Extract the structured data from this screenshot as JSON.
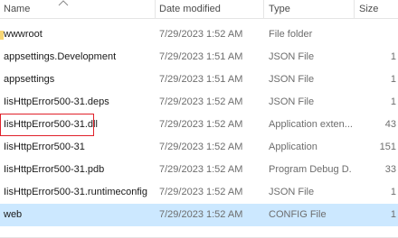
{
  "columns": {
    "name": "Name",
    "date": "Date modified",
    "type": "Type",
    "size": "Size"
  },
  "sort": {
    "column": "name",
    "direction": "ascending",
    "icon": "chevron-up-icon"
  },
  "files": [
    {
      "name": "wwwroot",
      "date": "7/29/2023 1:52 AM",
      "type": "File folder",
      "size": "",
      "icon": "folder-icon"
    },
    {
      "name": "appsettings.Development",
      "date": "7/29/2023 1:51 AM",
      "type": "JSON File",
      "size": "1"
    },
    {
      "name": "appsettings",
      "date": "7/29/2023 1:51 AM",
      "type": "JSON File",
      "size": "1"
    },
    {
      "name": "IisHttpError500-31.deps",
      "date": "7/29/2023 1:52 AM",
      "type": "JSON File",
      "size": "1"
    },
    {
      "name": "IisHttpError500-31.dll",
      "date": "7/29/2023 1:52 AM",
      "type": "Application exten...",
      "size": "43",
      "highlighted": true
    },
    {
      "name": "IisHttpError500-31",
      "date": "7/29/2023 1:52 AM",
      "type": "Application",
      "size": "151"
    },
    {
      "name": "IisHttpError500-31.pdb",
      "date": "7/29/2023 1:52 AM",
      "type": "Program Debug D...",
      "size": "33"
    },
    {
      "name": "IisHttpError500-31.runtimeconfig",
      "date": "7/29/2023 1:52 AM",
      "type": "JSON File",
      "size": "1"
    },
    {
      "name": "web",
      "date": "7/29/2023 1:52 AM",
      "type": "CONFIG File",
      "size": "1",
      "selected": true
    }
  ],
  "colors": {
    "selection": "#cce8ff",
    "highlight_border": "#e0212a",
    "folder": "#f8d775"
  }
}
